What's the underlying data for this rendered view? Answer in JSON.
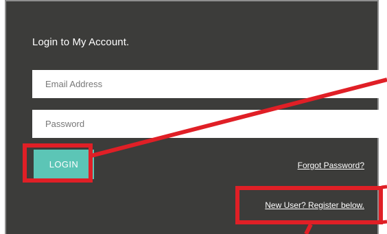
{
  "login": {
    "title": "Login to My Account.",
    "email_placeholder": "Email Address",
    "password_placeholder": "Password",
    "email_value": "",
    "password_value": "",
    "login_button": "LOGIN",
    "forgot_password_link": "Forgot Password?",
    "register_link": "New User? Register below."
  },
  "colors": {
    "panel_background": "#3c3c3a",
    "login_button": "#5cc5b6",
    "annotation_red": "#e01f26",
    "text": "#ffffff"
  }
}
